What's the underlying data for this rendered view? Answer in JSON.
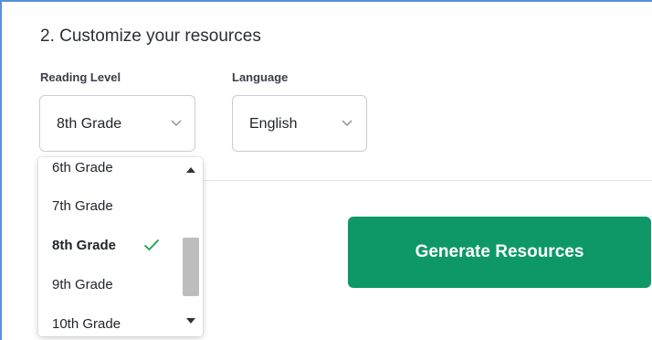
{
  "section": {
    "title": "2. Customize your resources"
  },
  "reading_level": {
    "label": "Reading Level",
    "value": "8th Grade",
    "options": [
      {
        "label": "6th Grade",
        "selected": false
      },
      {
        "label": "7th Grade",
        "selected": false
      },
      {
        "label": "8th Grade",
        "selected": true
      },
      {
        "label": "9th Grade",
        "selected": false
      },
      {
        "label": "10th Grade",
        "selected": false
      }
    ]
  },
  "language": {
    "label": "Language",
    "value": "English"
  },
  "actions": {
    "generate_label": "Generate Resources"
  },
  "colors": {
    "accent": "#0e9868",
    "frame_border": "#5b8fd8",
    "checkmark": "#16a34a",
    "scroll_thumb": "#bdbdbd"
  },
  "icons": {
    "select_chevron": "chevron-down-icon",
    "selected_marker": "check-icon",
    "scroll_up": "scroll-up-arrow",
    "scroll_down": "scroll-down-arrow"
  }
}
